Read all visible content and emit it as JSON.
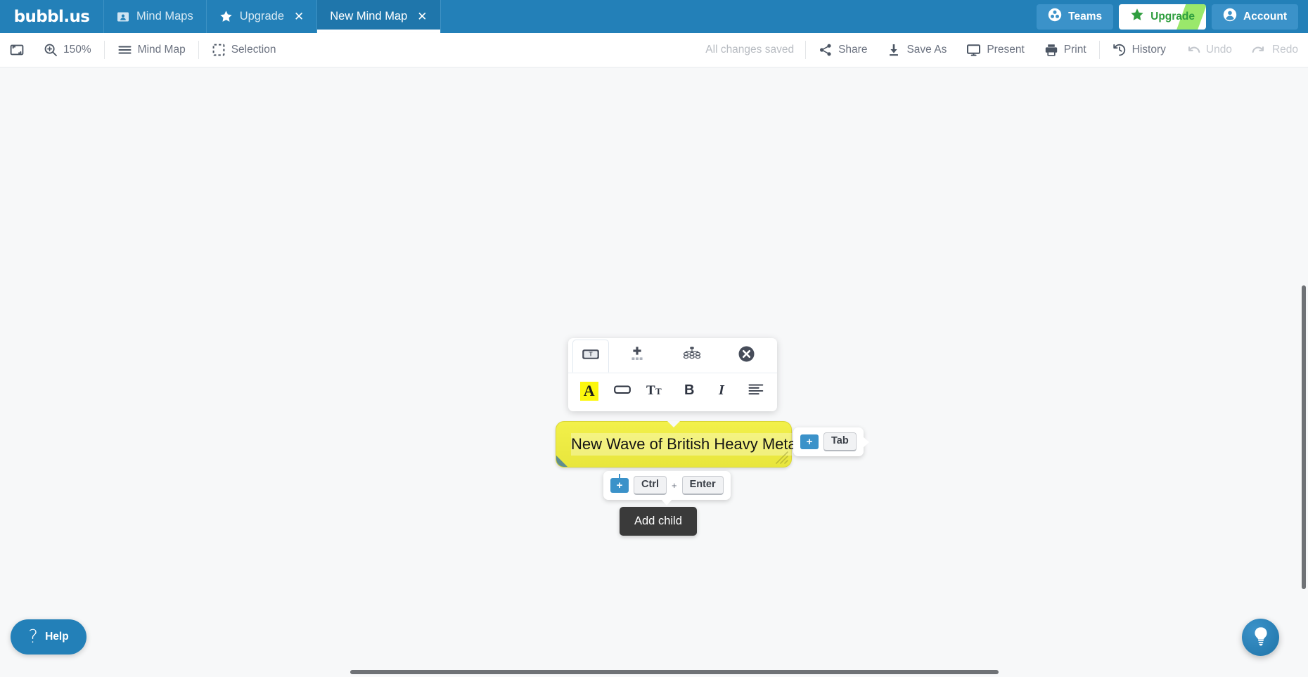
{
  "app": {
    "brand": "bubbl.us"
  },
  "tabs": [
    {
      "label": "Mind Maps",
      "icon": "folder-icon",
      "closable": false,
      "active": false
    },
    {
      "label": "Upgrade",
      "icon": "star-icon",
      "closable": true,
      "active": false
    },
    {
      "label": "New Mind Map",
      "icon": "",
      "closable": true,
      "active": true
    }
  ],
  "account_bar": {
    "teams_label": "Teams",
    "teams_icon": "teams-icon",
    "upgrade_label": "Upgrade",
    "upgrade_icon": "star-icon",
    "upgrade_text_color": "#2f9e3f",
    "upgrade_stripe_color": "#9ae86b",
    "account_label": "Account",
    "account_icon": "user-circle-icon"
  },
  "toolbar": {
    "fit_icon": "fit-to-screen-icon",
    "zoom_icon": "magnifier-plus-icon",
    "zoom_level": "150%",
    "view_icon": "hamburger-icon",
    "view_label": "Mind Map",
    "selection_icon": "dashed-square-icon",
    "selection_label": "Selection",
    "status": "All changes saved",
    "actions": [
      {
        "label": "Share",
        "icon": "share-icon",
        "disabled": false
      },
      {
        "label": "Save As",
        "icon": "download-icon",
        "disabled": false
      },
      {
        "label": "Present",
        "icon": "monitor-icon",
        "disabled": false
      },
      {
        "label": "Print",
        "icon": "printer-icon",
        "disabled": false
      }
    ],
    "history_actions": [
      {
        "label": "History",
        "icon": "clock-history-icon",
        "disabled": false
      },
      {
        "label": "Undo",
        "icon": "undo-arrow-icon",
        "disabled": true
      },
      {
        "label": "Redo",
        "icon": "redo-arrow-icon",
        "disabled": true
      }
    ]
  },
  "format_panel": {
    "row1": [
      {
        "name": "text-bubble-tab",
        "icon": "bubble-text-icon",
        "selected": true
      },
      {
        "name": "add-bubble",
        "icon": "plus-dots-icon",
        "selected": false
      },
      {
        "name": "hierarchy-layout",
        "icon": "hierarchy-icon",
        "selected": false
      },
      {
        "name": "close-panel",
        "icon": "close-circle-icon",
        "selected": false
      }
    ],
    "row2": [
      {
        "name": "text-color",
        "icon": "letter-a-highlight-icon",
        "glyph": "A",
        "highlight": "#fcf70d"
      },
      {
        "name": "fill-color",
        "icon": "rounded-rect-icon",
        "glyph": ""
      },
      {
        "name": "font-size",
        "icon": "font-size-icon",
        "glyph": "Tt"
      },
      {
        "name": "bold",
        "icon": "bold-icon",
        "glyph": "B"
      },
      {
        "name": "italic",
        "icon": "italic-icon",
        "glyph": "I"
      },
      {
        "name": "align",
        "icon": "align-left-icon",
        "glyph": ""
      }
    ]
  },
  "bubble": {
    "text": "New Wave of British Heavy Metal",
    "fill_color": "#f0ee45",
    "border_color": "#d9d635",
    "corner_color": "#5f8d90",
    "editing": true
  },
  "hints": {
    "add_sibling": {
      "plus_icon": "plus-badge-icon",
      "keys": [
        "Ctrl",
        "Enter"
      ],
      "separator": "+"
    },
    "add_child": {
      "plus_icon": "plus-badge-icon",
      "keys": [
        "Tab"
      ]
    }
  },
  "tooltip": {
    "text": "Add child"
  },
  "help": {
    "icon": "question-mark-icon",
    "label": "Help"
  },
  "assistant": {
    "icon": "lightbulb-icon"
  }
}
